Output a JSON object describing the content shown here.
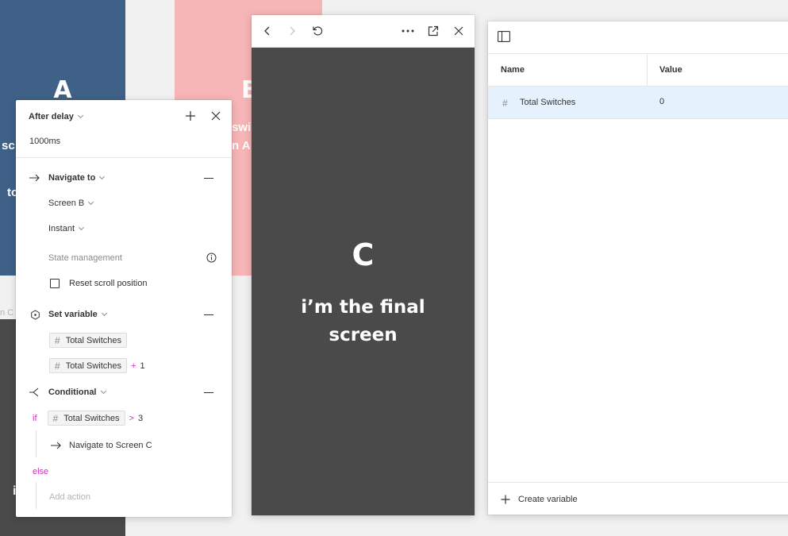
{
  "canvas": {
    "frame_a": {
      "letter": "A",
      "lines": [
        "w",
        "sc",
        "to"
      ]
    },
    "frame_b": {
      "letter": "B",
      "lines": [
        "swi",
        "n A"
      ]
    },
    "frame_c_label": "n C",
    "frame_c_fragment": "i"
  },
  "interaction": {
    "trigger_label": "After delay",
    "delay_value": "1000ms",
    "actions": {
      "navigate": {
        "label": "Navigate to",
        "destination": "Screen B",
        "animation": "Instant",
        "state_management_label": "State management",
        "reset_scroll_label": "Reset scroll position",
        "reset_scroll_checked": false
      },
      "set_variable": {
        "label": "Set variable",
        "target": "Total Switches",
        "expr_variable": "Total Switches",
        "expr_operator": "+",
        "expr_value": "1"
      },
      "conditional": {
        "label": "Conditional",
        "if_keyword": "if",
        "condition_variable": "Total Switches",
        "condition_operator": ">",
        "condition_value": "3",
        "then_action": "Navigate to Screen C",
        "else_keyword": "else",
        "add_action_placeholder": "Add action"
      }
    }
  },
  "viewer": {
    "screen_letter": "C",
    "screen_message_line1": "i’m the final",
    "screen_message_line2": "screen"
  },
  "variables": {
    "columns": {
      "name": "Name",
      "value": "Value"
    },
    "rows": [
      {
        "name": "Total Switches",
        "value": "0",
        "type_icon": "hash-icon"
      }
    ],
    "create_label": "Create variable"
  },
  "colors": {
    "frame_a": "#3f6187",
    "frame_b": "#f6b5b6",
    "screen_dark": "#4a4a4a",
    "accent_magenta": "#d12ec2",
    "selected_row": "#e5f2fd"
  }
}
